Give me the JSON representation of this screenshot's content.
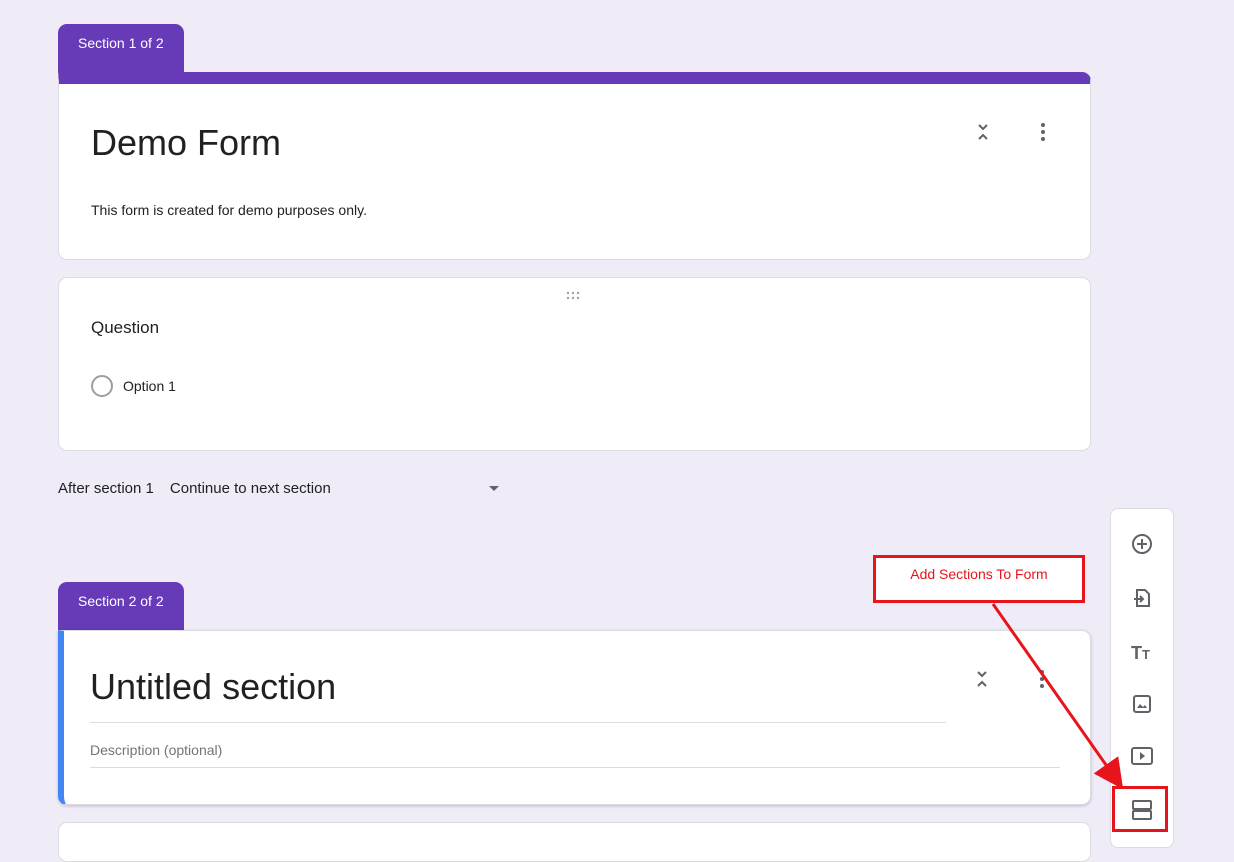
{
  "section1": {
    "tab_label": "Section 1 of 2",
    "title": "Demo Form",
    "description": "This form is created for demo purposes only."
  },
  "question": {
    "label": "Question",
    "option1": "Option 1"
  },
  "after_section": {
    "label": "After section 1",
    "value": "Continue to next section"
  },
  "section2": {
    "tab_label": "Section 2 of 2",
    "title": "Untitled section",
    "description_placeholder": "Description (optional)"
  },
  "annotation": {
    "label": "Add Sections To Form",
    "color": "#e8141c"
  },
  "toolbar": {
    "items": [
      "add-question-icon",
      "import-questions-icon",
      "add-title-icon",
      "add-image-icon",
      "add-video-icon",
      "add-section-icon"
    ]
  },
  "colors": {
    "accent": "#673ab7",
    "background": "#efebf7",
    "section_active_bar": "#4285f4"
  }
}
